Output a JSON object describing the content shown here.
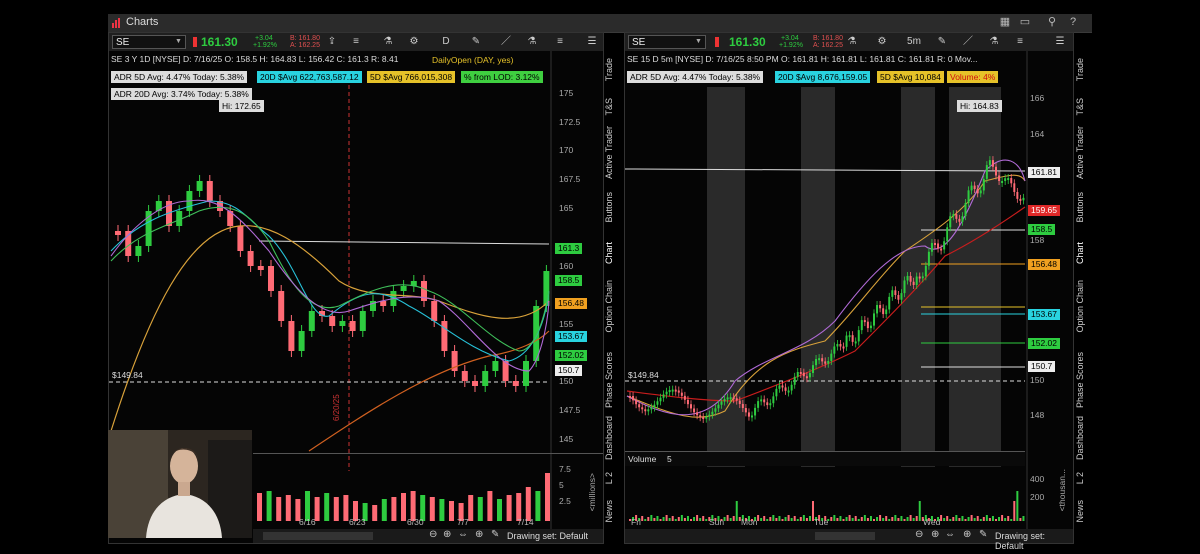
{
  "window": {
    "title": "Charts"
  },
  "left": {
    "symbol": "SE",
    "last": "161.30",
    "change": "+3.04",
    "change_pct": "+1.92%",
    "bid": "B: 161.80",
    "ask": "A: 162.25",
    "period_btn": "D",
    "info_line": "SE 3 Y 1D [NYSE]   D: 7/16/25   O: 158.5   H: 164.83   L: 156.42   C: 161.3   R: 8.41",
    "daily_open": "DailyOpen (DAY, yes)",
    "adr5": "ADR 5D Avg: 4.47%  Today: 5.38%",
    "adr20": "ADR 20D Avg: 3.74%  Today: 5.38%",
    "savg20": "20D $Avg 622,763,587.12",
    "savg5": "5D $Avg 766,015,308",
    "from_lod": "% from LOD: 3.12%",
    "hi": "Hi: 172.65",
    "y_ticks": [
      "175",
      "172.5",
      "170",
      "167.5",
      "165",
      "162.5",
      "160",
      "157.5",
      "155",
      "152.5",
      "150",
      "147.5",
      "145"
    ],
    "labels": {
      "p161": "161.3",
      "p1585": "158.5",
      "p15648": "156.48",
      "p15367": "153.67",
      "p15202": "152.02",
      "p1507": "150.7"
    },
    "level": "$149.84",
    "x_ticks": [
      "6/16",
      "6/23",
      "6/30",
      "7/7",
      "7/14"
    ],
    "vol_ticks": [
      "7.5",
      "5",
      "2.5"
    ],
    "vol_unit": "<millions>",
    "status": "Drawing set: Default",
    "vertical_date": "6/20/25"
  },
  "right": {
    "symbol": "SE",
    "last": "161.30",
    "change": "+3.04",
    "change_pct": "+1.92%",
    "bid": "B: 161.80",
    "ask": "A: 162.25",
    "period_btn": "5m",
    "info_line": "SE 15 D 5m [NYSE]   D: 7/16/25 8:50 PM   O: 161.81   H: 161.81   L: 161.81   C: 161.81   R: 0   Mov...",
    "adr5": "ADR 5D Avg: 4.47%  Today: 5.38%",
    "savg20": "20D $Avg 8,676,159.05",
    "savg5": "5D $Avg 10,084",
    "volume_pct": "Volume: 4%",
    "hi": "Hi: 164.83",
    "y_ticks": [
      "166",
      "164",
      "162",
      "160",
      "158",
      "156",
      "154",
      "152",
      "150",
      "148"
    ],
    "labels": {
      "p16181": "161.81",
      "p15965": "159.65",
      "p1585": "158.5",
      "p15648": "156.48",
      "p15367": "153.67",
      "p15202": "152.02",
      "p1507": "150.7"
    },
    "level": "$149.84",
    "volume_label": "Volume",
    "volume_value": "5",
    "x_ticks": [
      "Fri",
      "Sun",
      "Mon",
      "Tue",
      "Wed"
    ],
    "vol_ticks": [
      "400",
      "200"
    ],
    "vol_unit": "<thousan...",
    "status": "Drawing set: Default"
  },
  "side_tabs": [
    "Trade",
    "T&S",
    "Active Trader",
    "Buttons",
    "Chart",
    "Option Chain",
    "Phase Scores",
    "Dashboard",
    "L 2",
    "News"
  ],
  "colors": {
    "up": "#2ecc40",
    "down": "#ff6b75",
    "cyan": "#29d3e0",
    "orange": "#f0a020",
    "yellow": "#e6c229"
  }
}
